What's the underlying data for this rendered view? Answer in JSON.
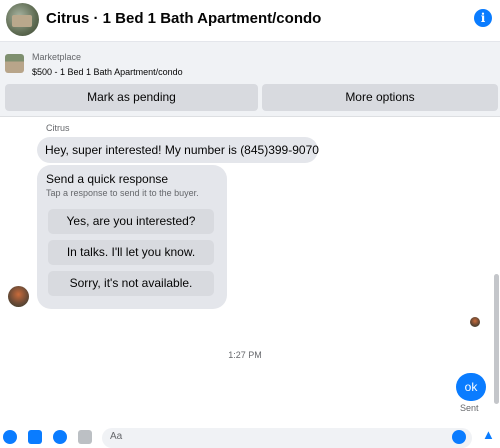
{
  "header": {
    "title": "Citrus · 1 Bed 1 Bath Apartment/condo",
    "info_icon": "info-icon",
    "accent_color": "#0a7cff"
  },
  "marketplace": {
    "label": "Marketplace",
    "listing": "$500 - 1 Bed 1 Bath Apartment/condo",
    "buttons": {
      "pending": "Mark as pending",
      "more": "More options"
    }
  },
  "thread": {
    "sender_name": "Citrus",
    "incoming_message": "Hey, super interested! My number is (845)399-9070",
    "quick_response": {
      "title": "Send a quick response",
      "subtitle": "Tap a response to send it to the buyer.",
      "options": [
        "Yes, are you interested?",
        "In talks. I'll let you know.",
        "Sorry, it's not available."
      ]
    },
    "timestamp": "1:27 PM",
    "outgoing_message": "ok",
    "status": "Sent"
  },
  "composer": {
    "placeholder": "Aa"
  }
}
